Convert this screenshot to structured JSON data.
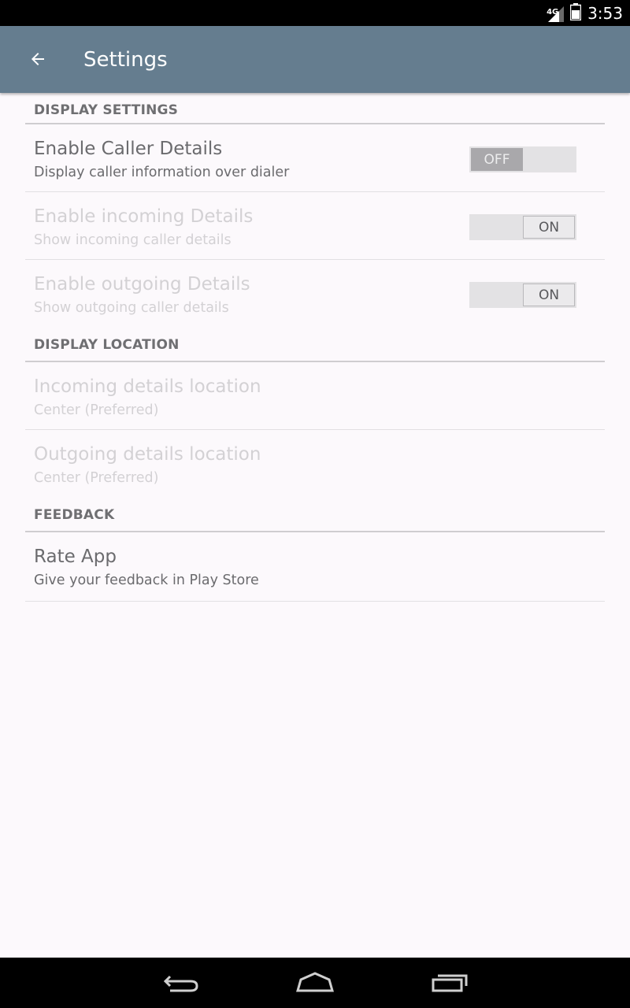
{
  "status_bar": {
    "network_label": "4G",
    "time": "3:53",
    "icons": [
      "signal-icon",
      "battery-icon"
    ]
  },
  "app_bar": {
    "title": "Settings",
    "back_icon": "arrow-left-icon"
  },
  "sections": [
    {
      "header": "DISPLAY SETTINGS",
      "items": [
        {
          "title": "Enable Caller Details",
          "summary": "Display caller information over dialer",
          "toggle": "OFF",
          "enabled": true
        },
        {
          "title": "Enable incoming Details",
          "summary": "Show incoming caller details",
          "toggle": "ON",
          "enabled": false
        },
        {
          "title": "Enable outgoing Details",
          "summary": "Show outgoing caller details",
          "toggle": "ON",
          "enabled": false
        }
      ]
    },
    {
      "header": "DISPLAY LOCATION",
      "items": [
        {
          "title": "Incoming details location",
          "summary": "Center (Preferred)",
          "enabled": false
        },
        {
          "title": "Outgoing details location",
          "summary": "Center (Preferred)",
          "enabled": false
        }
      ]
    },
    {
      "header": "FEEDBACK",
      "items": [
        {
          "title": "Rate App",
          "summary": "Give your feedback in Play Store",
          "enabled": true
        }
      ]
    }
  ],
  "nav_bar": {
    "icons": [
      "back-nav-icon",
      "home-nav-icon",
      "recents-nav-icon"
    ]
  },
  "colors": {
    "app_bar": "#657d8f",
    "background": "#fcf9fc",
    "text_primary": "#6b6b6e",
    "text_disabled": "#d3d1d4",
    "divider": "#cfcdd0"
  }
}
